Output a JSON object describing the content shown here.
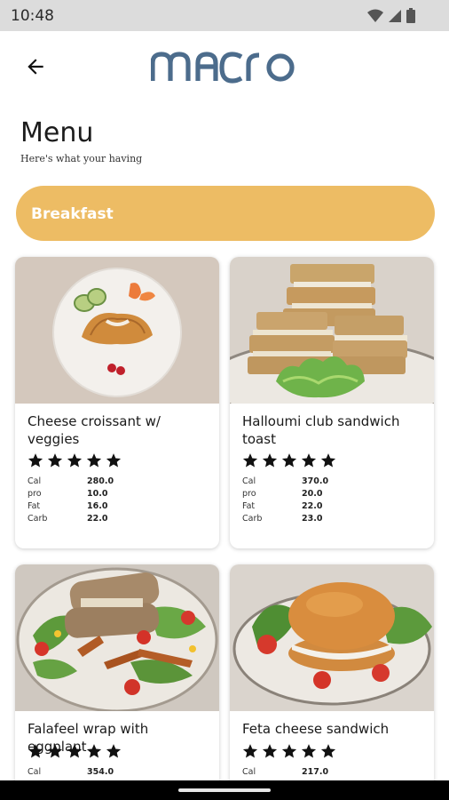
{
  "status_bar": {
    "time": "10:48"
  },
  "header": {
    "logo_text": "macro"
  },
  "page": {
    "title": "Menu",
    "subtitle": "Here's what your having"
  },
  "category": {
    "label": "Breakfast",
    "color": "#edbc64"
  },
  "items": [
    {
      "name": "Cheese croissant  w/ veggies",
      "rating": 5,
      "nutrition": [
        {
          "key": "Cal",
          "value": "280.0"
        },
        {
          "key": "pro",
          "value": "10.0"
        },
        {
          "key": "Fat",
          "value": "16.0"
        },
        {
          "key": "Carb",
          "value": "22.0"
        }
      ]
    },
    {
      "name": "Halloumi club sandwich toast",
      "rating": 5,
      "nutrition": [
        {
          "key": "Cal",
          "value": "370.0"
        },
        {
          "key": "pro",
          "value": "20.0"
        },
        {
          "key": "Fat",
          "value": "22.0"
        },
        {
          "key": "Carb",
          "value": "23.0"
        }
      ]
    },
    {
      "name": "Falafeel wrap with eggplant",
      "rating": 5,
      "nutrition": [
        {
          "key": "Cal",
          "value": "354.0"
        }
      ]
    },
    {
      "name": "Feta cheese sandwich",
      "rating": 5,
      "nutrition": [
        {
          "key": "Cal",
          "value": "217.0"
        }
      ]
    }
  ]
}
